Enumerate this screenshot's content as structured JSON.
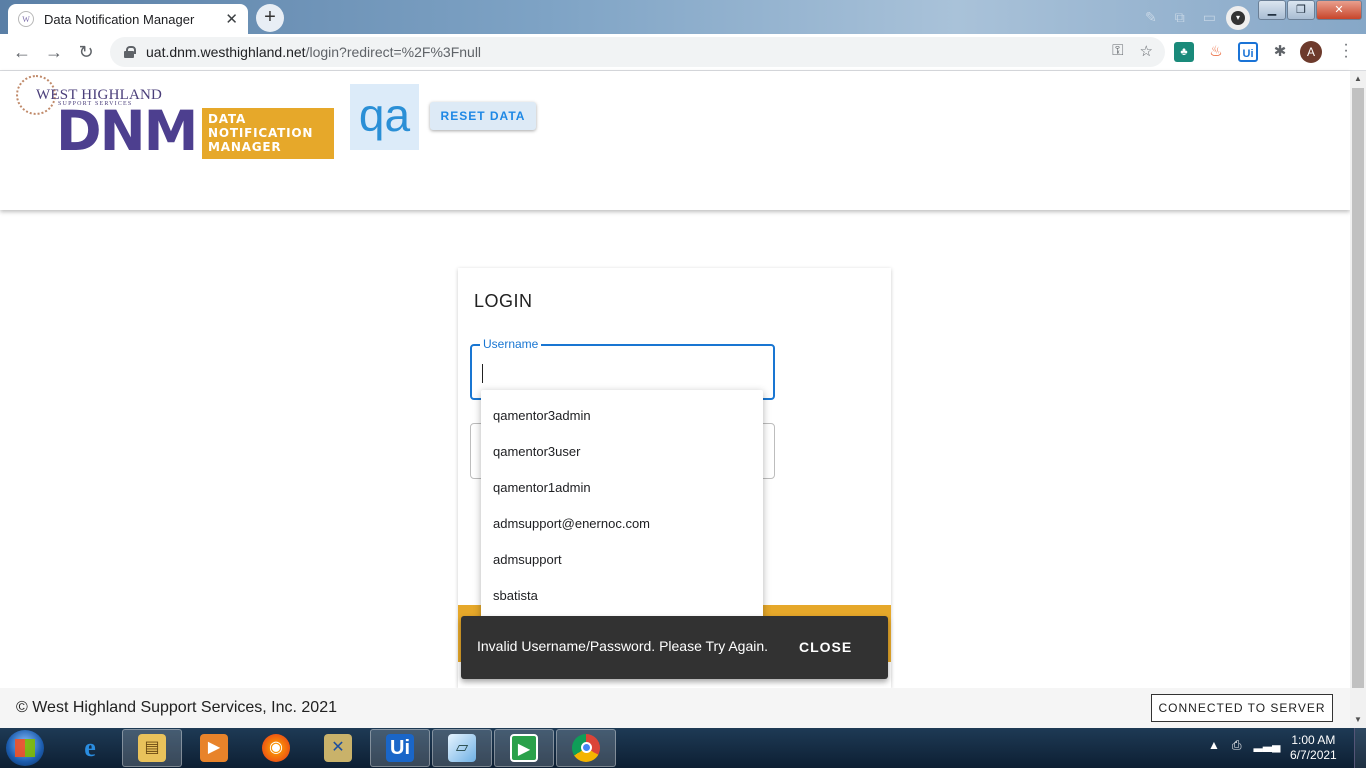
{
  "browser": {
    "tab_title": "Data Notification Manager",
    "tab_favicon": "W",
    "url_host": "uat.dnm.westhighland.net",
    "url_path": "/login?redirect=%2F%3Fnull",
    "profile_initial": "A"
  },
  "header": {
    "logo_company": "WEST HIGHLAND",
    "logo_sub": "SUPPORT SERVICES",
    "logo_dnm": "DNM",
    "logo_box_line1": "DATA",
    "logo_box_line2": "NOTIFICATION",
    "logo_box_line3": "MANAGER",
    "env_badge": "qa",
    "reset_label": "RESET DATA"
  },
  "login": {
    "title": "LOGIN",
    "username_label": "Username"
  },
  "autocomplete": {
    "items": [
      "qamentor3admin",
      "qamentor3user",
      "qamentor1admin",
      "admsupport@enernoc.com",
      "admsupport",
      "sbatista"
    ]
  },
  "snackbar": {
    "message": "Invalid Username/Password. Please Try Again.",
    "close_label": "CLOSE"
  },
  "footer": {
    "copyright": "© West Highland Support Services, Inc. 2021",
    "connection_label": "CONNECTED TO SERVER"
  },
  "taskbar": {
    "time": "1:00 AM",
    "date": "6/7/2021"
  },
  "colors": {
    "brand_purple": "#4d3f8f",
    "brand_gold": "#e6a82a",
    "accent_blue": "#1976d2"
  }
}
